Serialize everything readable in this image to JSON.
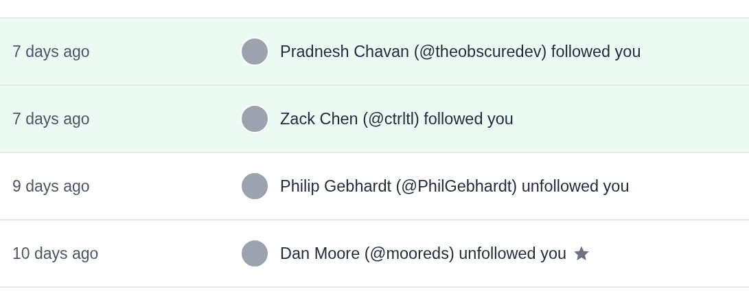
{
  "activity": [
    {
      "time": "7 days ago",
      "text": "Pradnesh Chavan (@theobscuredev) followed you",
      "highlighted": true,
      "starred": false
    },
    {
      "time": "7 days ago",
      "text": "Zack Chen (@ctrltl) followed you",
      "highlighted": true,
      "starred": false
    },
    {
      "time": "9 days ago",
      "text": "Philip Gebhardt (@PhilGebhardt) unfollowed you",
      "highlighted": false,
      "starred": false
    },
    {
      "time": "10 days ago",
      "text": "Dan Moore (@mooreds) unfollowed you",
      "highlighted": false,
      "starred": true
    }
  ]
}
